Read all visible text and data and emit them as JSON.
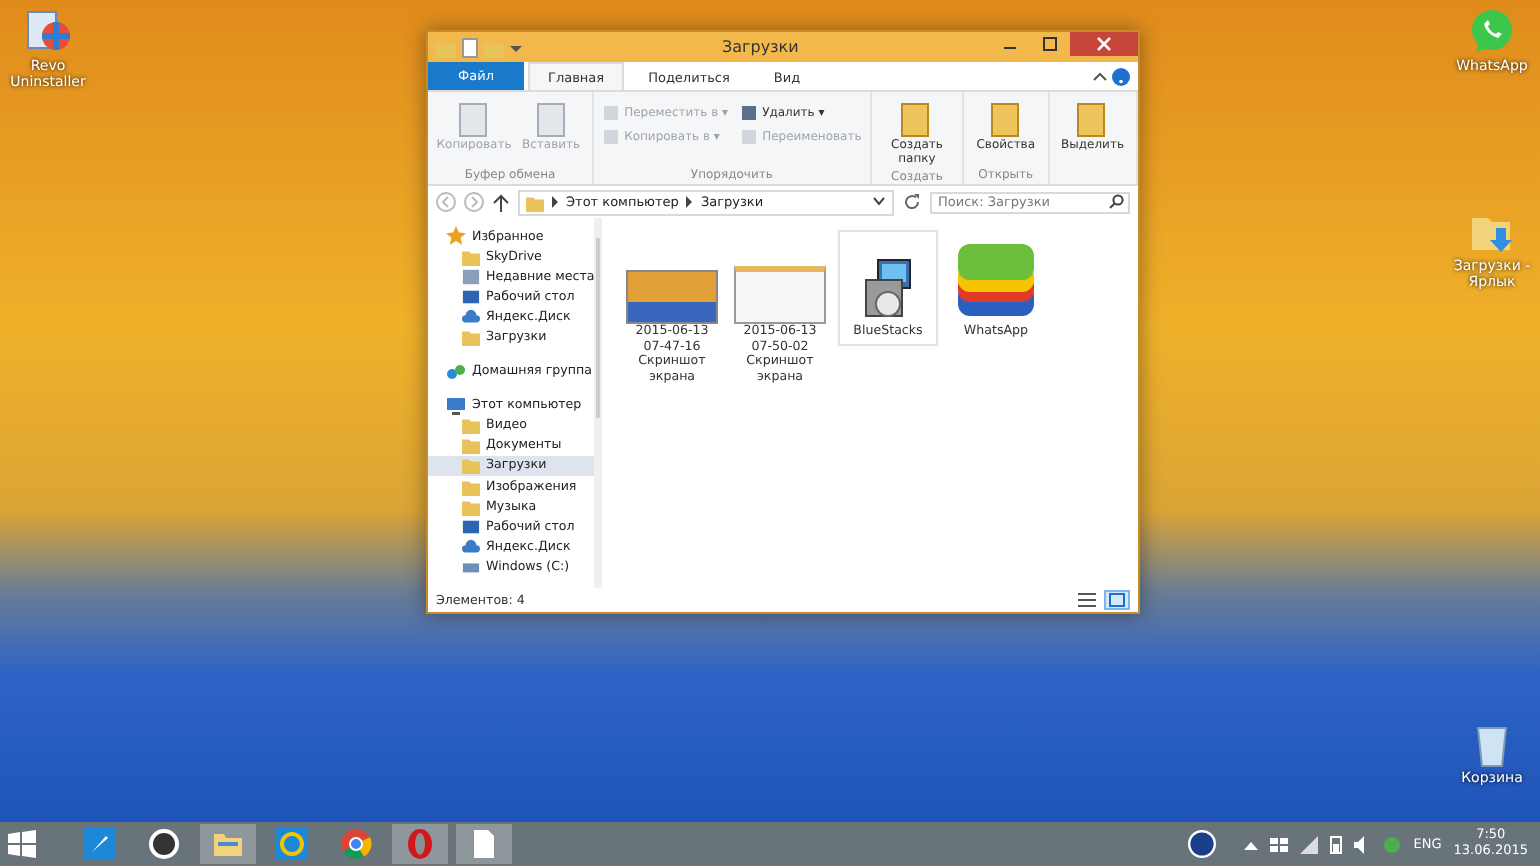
{
  "desktop_icons": [
    {
      "label": "Revo Uninstaller",
      "kind": "uninstaller"
    },
    {
      "label": "WhatsApp",
      "kind": "chat"
    },
    {
      "label": "Загрузки - Ярлык",
      "kind": "folder"
    },
    {
      "label": "Корзина",
      "kind": "bin"
    }
  ],
  "window": {
    "title": "Загрузки",
    "ribbon_tabs": [
      {
        "label": "Файл",
        "kind": "file",
        "selected": false
      },
      {
        "label": "Главная",
        "kind": "tab",
        "selected": true
      },
      {
        "label": "Поделиться",
        "kind": "tab",
        "selected": false
      },
      {
        "label": "Вид",
        "kind": "tab",
        "selected": false
      }
    ],
    "ribbon_groups": [
      {
        "label": "Буфер обмена",
        "items": [
          {
            "label": "Копировать",
            "kind": "large",
            "disabled": true
          },
          {
            "label": "Вставить",
            "kind": "large",
            "disabled": true
          }
        ]
      },
      {
        "label": "Упорядочить",
        "items": [
          {
            "label": "Переместить в ▾",
            "kind": "small",
            "disabled": true
          },
          {
            "label": "Удалить ▾",
            "kind": "small",
            "disabled": false
          },
          {
            "label": "Копировать в ▾",
            "kind": "small",
            "disabled": true
          },
          {
            "label": "Переименовать",
            "kind": "small",
            "disabled": true
          }
        ]
      },
      {
        "label": "Создать",
        "items": [
          {
            "label": "Создать папку",
            "kind": "large",
            "disabled": false
          }
        ]
      },
      {
        "label": "Открыть",
        "items": [
          {
            "label": "Свойства",
            "kind": "large",
            "disabled": false
          }
        ]
      },
      {
        "items": [
          {
            "label": "Выделить",
            "kind": "large",
            "disabled": false
          }
        ]
      }
    ],
    "breadcrumbs": [
      "Этот компьютер",
      "Загрузки"
    ],
    "search": {
      "placeholder": "Поиск: Загрузки"
    },
    "nav_tree": [
      {
        "label": "Избранное",
        "kind": "star",
        "children": [
          {
            "label": "SkyDrive",
            "kind": "folder",
            "selected": false
          },
          {
            "label": "Недавние места",
            "kind": "recent",
            "selected": false
          },
          {
            "label": "Рабочий стол",
            "kind": "desktop",
            "selected": false
          },
          {
            "label": "Яндекс.Диск",
            "kind": "cloud",
            "selected": false
          },
          {
            "label": "Загрузки",
            "kind": "folder",
            "selected": false
          }
        ]
      },
      {
        "label": "Домашняя группа",
        "kind": "group"
      },
      {
        "label": "Этот компьютер",
        "kind": "pc",
        "children": [
          {
            "label": "Видео",
            "kind": "folder",
            "selected": false
          },
          {
            "label": "Документы",
            "kind": "folder",
            "selected": false
          },
          {
            "label": "Загрузки",
            "kind": "folder",
            "selected": true
          },
          {
            "label": "Изображения",
            "kind": "folder",
            "selected": false
          },
          {
            "label": "Музыка",
            "kind": "folder",
            "selected": false
          },
          {
            "label": "Рабочий стол",
            "kind": "desktop",
            "selected": false
          },
          {
            "label": "Яндекс.Диск",
            "kind": "cloud",
            "selected": false
          },
          {
            "label": "Windows (C:)",
            "kind": "drive",
            "selected": false
          }
        ]
      }
    ],
    "files": [
      {
        "label": "2015-06-13 07-47-16 Скриншот экрана",
        "kind": "photo",
        "selected": false
      },
      {
        "label": "2015-06-13 07-50-02 Скриншот экрана",
        "kind": "screen",
        "selected": false
      },
      {
        "label": "BlueStacks",
        "kind": "installer",
        "selected": true
      },
      {
        "label": "WhatsApp",
        "kind": "stack",
        "selected": false
      }
    ],
    "status_bar": "Элементов: 4",
    "views": [
      {
        "kind": "details",
        "selected": false
      },
      {
        "kind": "icons",
        "selected": true
      }
    ]
  },
  "taskbar": {
    "apps": [
      {
        "kind": "rocket",
        "active": false
      },
      {
        "kind": "hp",
        "active": false
      },
      {
        "kind": "explorer",
        "active": true
      },
      {
        "kind": "mail",
        "active": false
      },
      {
        "kind": "chrome",
        "active": false
      },
      {
        "kind": "opera",
        "active": true
      },
      {
        "kind": "notepad",
        "active": true
      }
    ],
    "language": "ENG",
    "time": "7:50",
    "date": "13.06.2015"
  }
}
